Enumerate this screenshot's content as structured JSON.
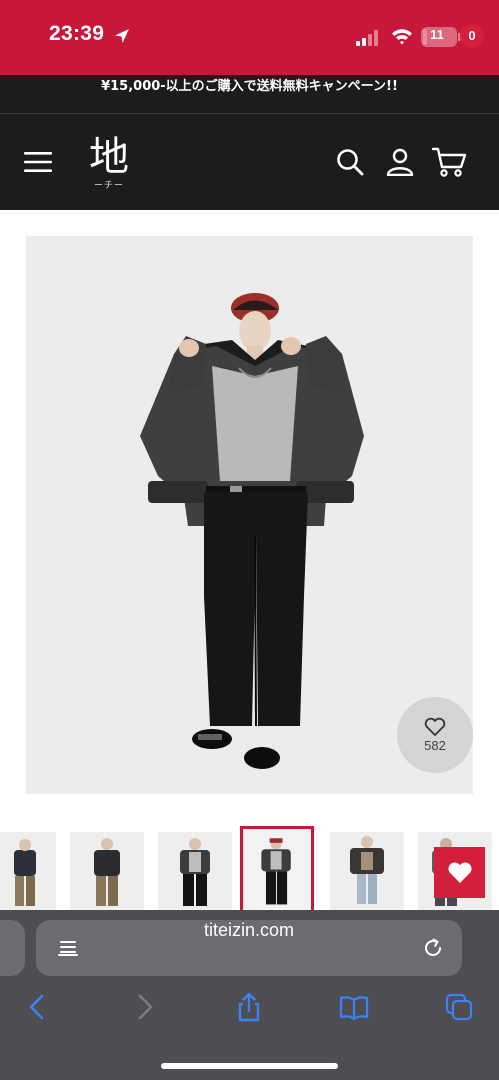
{
  "status_bar": {
    "time": "23:39",
    "battery": "11",
    "battery_level": 0.11,
    "icons": [
      "location-arrow-icon",
      "signal-icon",
      "wifi-icon",
      "battery-icon"
    ]
  },
  "announcement": {
    "text": "¥15,000-以上のご購入で送料無料キャンペーン!!"
  },
  "header": {
    "logo_main": "地",
    "logo_sub": "ーチー",
    "cart_count": "0",
    "icons": [
      "menu-icon",
      "search-icon",
      "account-icon",
      "cart-icon"
    ]
  },
  "product": {
    "likes": "582",
    "like_icon": "heart-outline-icon"
  },
  "thumbnails": {
    "count_visible": 6,
    "selected_index": 3
  },
  "wishlist": {
    "icon": "heart-icon",
    "color": "#d21f3c"
  },
  "browser": {
    "url": "titeizin.com",
    "toolbar_icons": [
      "back-icon",
      "forward-icon",
      "share-icon",
      "bookmarks-icon",
      "tabs-icon"
    ]
  },
  "colors": {
    "status_bar": "#c8183a",
    "header_bg": "#1d1c1d",
    "accent": "#d21f3c",
    "safari_bar": "#4e4d52",
    "toolbar_icon": "#3b82f6"
  }
}
